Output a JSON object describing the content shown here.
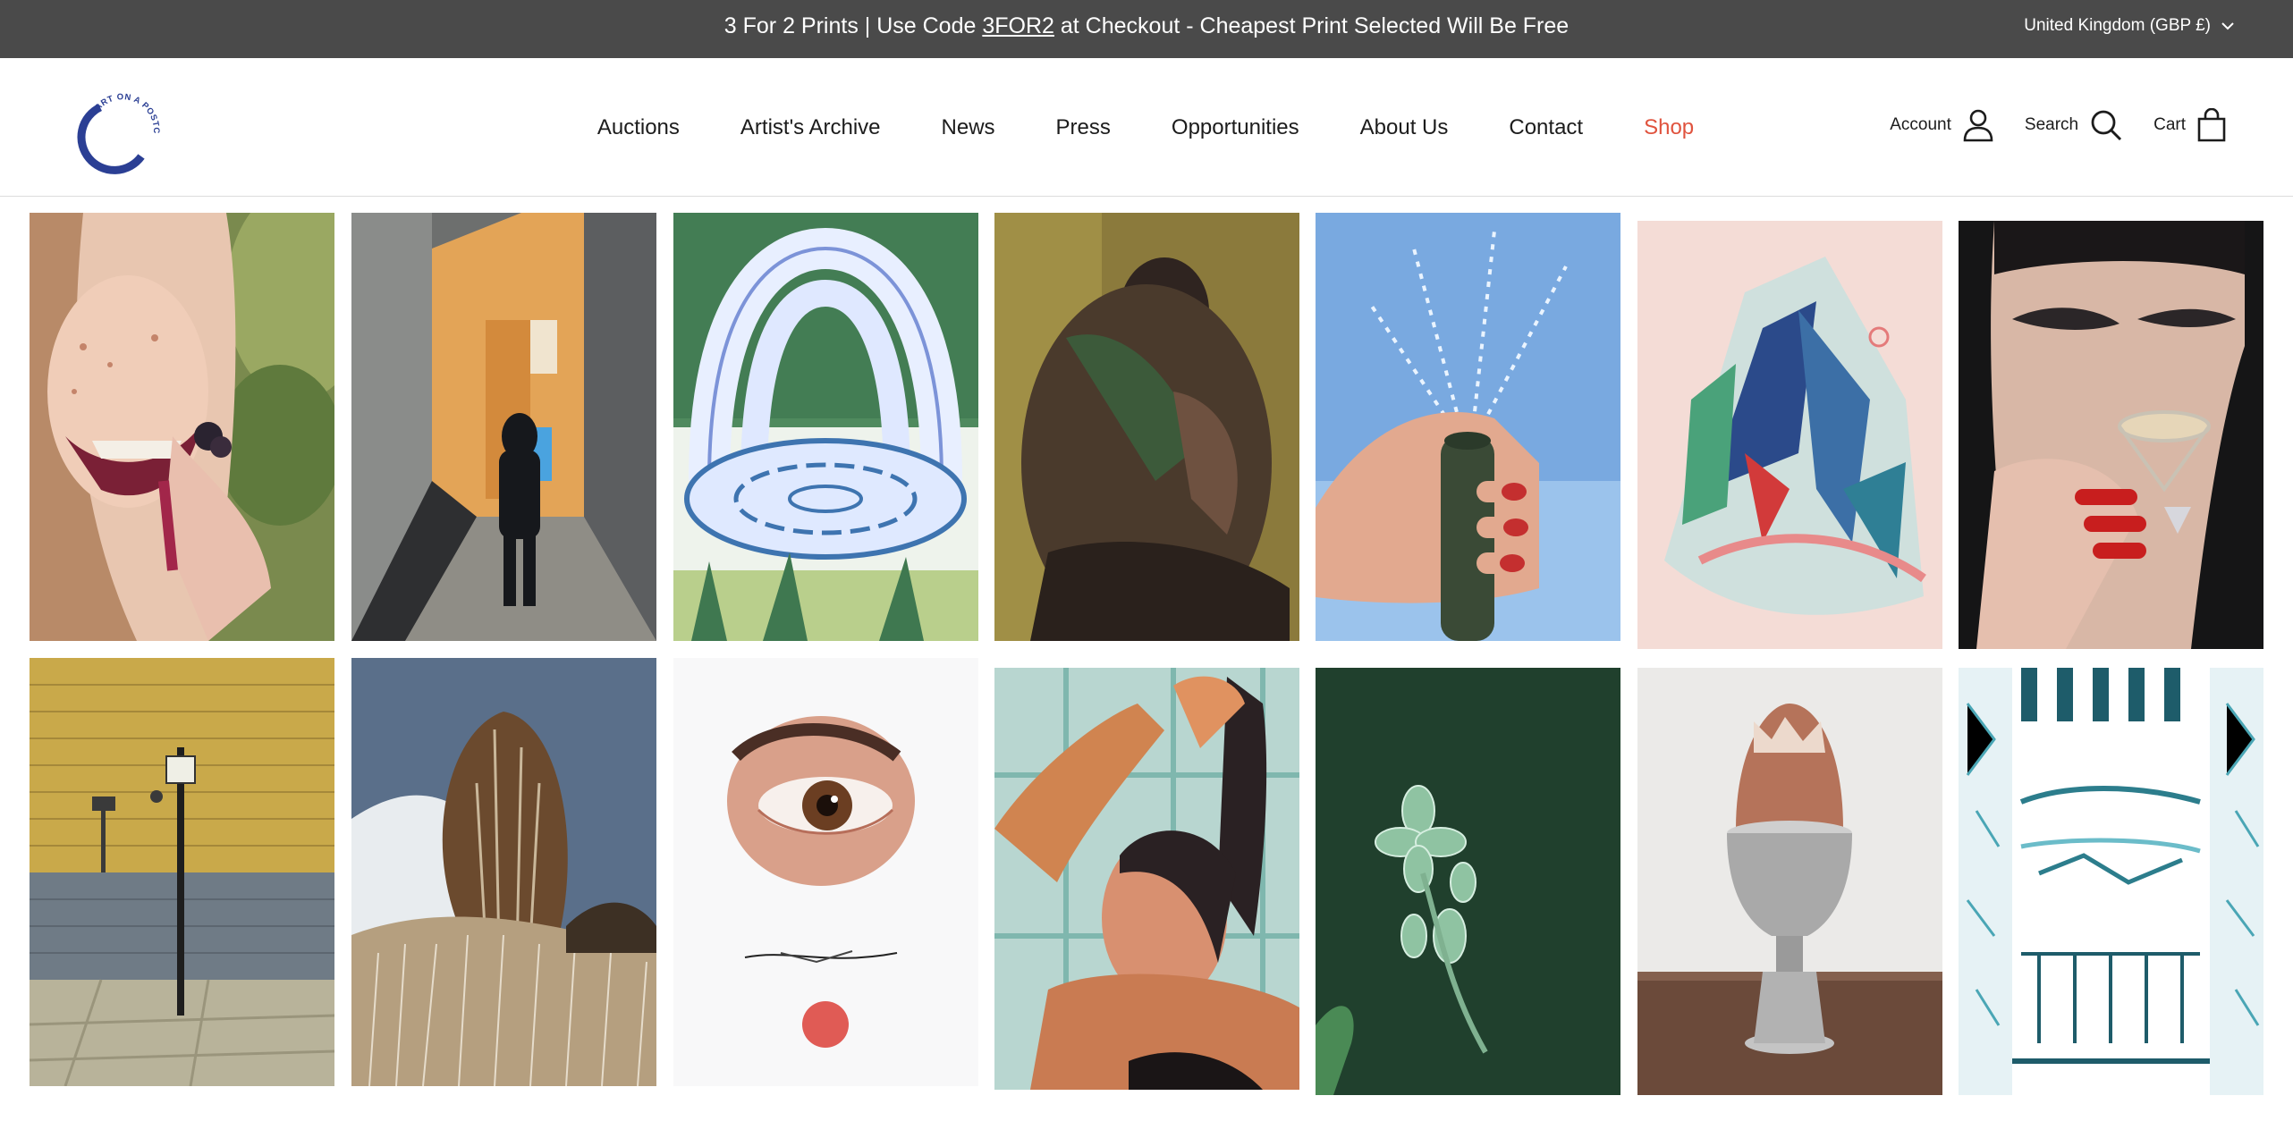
{
  "announcement": {
    "text_before": "3 For 2 Prints | Use Code ",
    "code": "3FOR2",
    "text_after": " at Checkout - Cheapest Print Selected Will Be Free"
  },
  "country_selector": {
    "label": "United Kingdom (GBP £)"
  },
  "logo": {
    "text": "ART ON A POSTCARD",
    "color": "#2b3f94"
  },
  "nav": {
    "items": [
      "Auctions",
      "Artist's Archive",
      "News",
      "Press",
      "Opportunities",
      "About Us",
      "Contact",
      "Shop"
    ],
    "shop_color": "#e0533e"
  },
  "header_utils": {
    "account": "Account",
    "search": "Search",
    "cart": "Cart"
  },
  "colors": {
    "announcement_bg": "#4a4a4a",
    "text": "#1c1c1c",
    "accent": "#e0533e"
  },
  "artworks": [
    {
      "subject": "woman-eating-berries"
    },
    {
      "subject": "figure-in-alleyway"
    },
    {
      "subject": "watercolour-fountain"
    },
    {
      "subject": "embracing-couple"
    },
    {
      "subject": "hand-with-hose"
    },
    {
      "subject": "abstract-mountain"
    },
    {
      "subject": "woman-with-cocktail"
    },
    {
      "subject": "brick-wall-lamppost"
    },
    {
      "subject": "tree-and-grass"
    },
    {
      "subject": "eye-and-red-circle"
    },
    {
      "subject": "woman-tying-hair"
    },
    {
      "subject": "floral-brooch"
    },
    {
      "subject": "egg-in-cup"
    },
    {
      "subject": "window-with-awning"
    }
  ]
}
